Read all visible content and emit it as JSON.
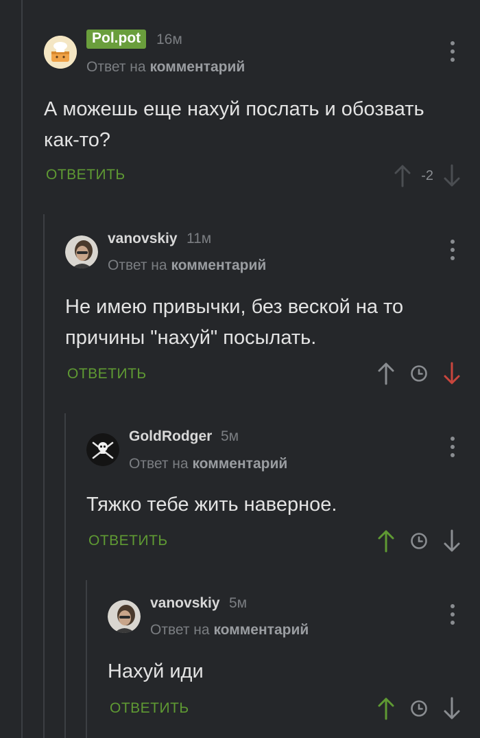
{
  "colors": {
    "background": "#25272a",
    "accent_green": "#5f9a33",
    "op_badge": "#6a9e3c",
    "vote_down_active": "#c9463d",
    "muted": "#7b7e82"
  },
  "comments": [
    {
      "author": "Pol.pot",
      "is_op": true,
      "time": "16м",
      "reply_prefix": "Ответ на",
      "reply_target": "комментарий",
      "text": "А можешь еще нахуй послать и обозвать как-то?",
      "reply_label": "ОТВЕТИТЬ",
      "rating": "-2",
      "upvote_icon": "arrow-up-icon",
      "downvote_icon": "arrow-down-icon",
      "vote_state": "none"
    },
    {
      "author": "vanovskiy",
      "is_op": false,
      "time": "11м",
      "reply_prefix": "Ответ на",
      "reply_target": "комментарий",
      "text": "Не имею привычки, без веской на то причины \"нахуй\" посылать.",
      "reply_label": "ОТВЕТИТЬ",
      "upvote_icon": "arrow-up-icon",
      "downvote_icon": "arrow-down-icon",
      "vote_state": "down"
    },
    {
      "author": "GoldRodger",
      "is_op": false,
      "time": "5м",
      "reply_prefix": "Ответ на",
      "reply_target": "комментарий",
      "text": "Тяжко тебе жить наверное.",
      "reply_label": "ОТВЕТИТЬ",
      "upvote_icon": "arrow-up-icon",
      "downvote_icon": "arrow-down-icon",
      "vote_state": "up"
    },
    {
      "author": "vanovskiy",
      "is_op": false,
      "time": "5м",
      "reply_prefix": "Ответ на",
      "reply_target": "комментарий",
      "text": "Нахуй иди",
      "reply_label": "ОТВЕТИТЬ",
      "upvote_icon": "arrow-up-icon",
      "downvote_icon": "arrow-down-icon",
      "vote_state": "up"
    }
  ]
}
